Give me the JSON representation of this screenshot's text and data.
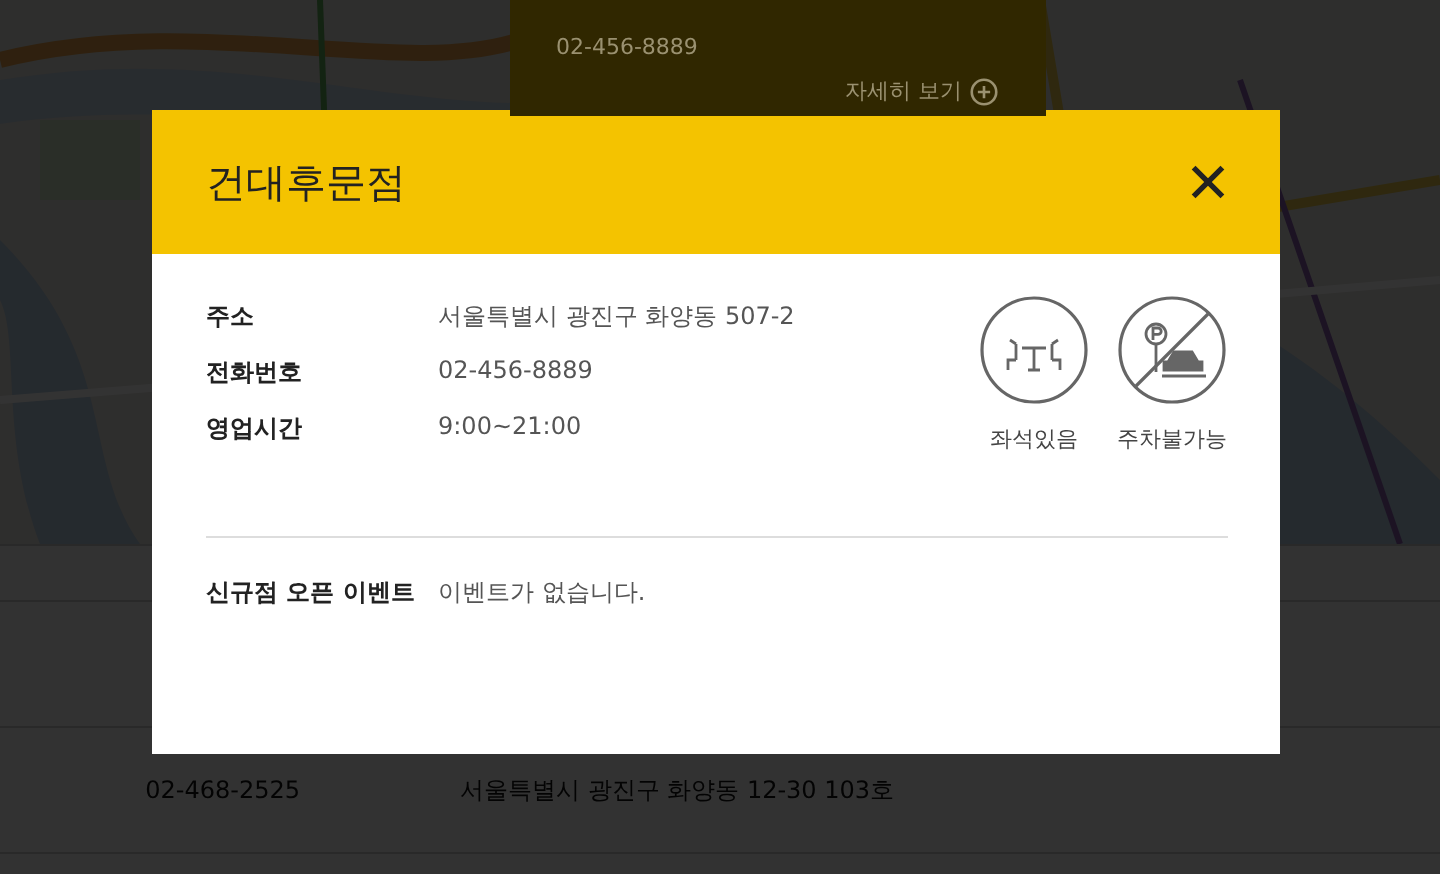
{
  "map_card": {
    "phone": "02-456-8889",
    "more_link": "자세히 보기"
  },
  "table": {
    "rows": [
      {
        "phone": "02-468-2525",
        "address": "서울특별시 광진구 화양동 12-30 103호"
      }
    ]
  },
  "modal": {
    "title": "건대후문점",
    "info": [
      {
        "label": "주소",
        "value": "서울특별시 광진구 화양동 507-2"
      },
      {
        "label": "전화번호",
        "value": "02-456-8889"
      },
      {
        "label": "영업시간",
        "value": "9:00~21:00"
      }
    ],
    "amenities": [
      {
        "kind": "seating",
        "label": "좌석있음",
        "available": true
      },
      {
        "kind": "parking",
        "label": "주차불가능",
        "available": false
      }
    ],
    "event": {
      "label": "신규점 오픈 이벤트",
      "value": "이벤트가 없습니다."
    }
  }
}
